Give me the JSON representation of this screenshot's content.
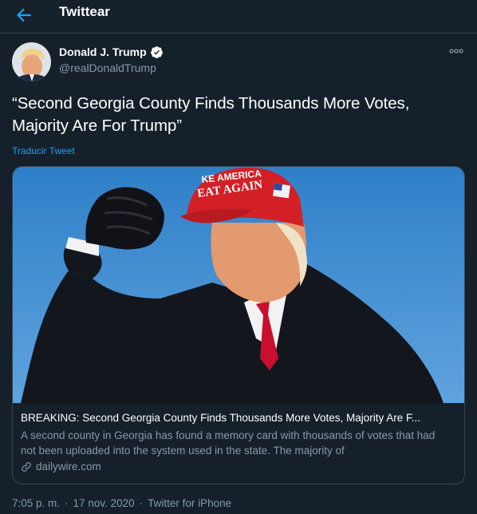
{
  "header": {
    "back_icon": "arrow-left-icon",
    "title": "Twittear"
  },
  "author": {
    "name": "Donald J. Trump",
    "handle": "@realDonaldTrump",
    "verified_icon": "verified-badge-icon"
  },
  "tweet": {
    "text": "“Second Georgia County Finds Thousands More Votes, Majority Are For Trump”",
    "translate_label": "Traducir Tweet"
  },
  "card": {
    "title": "BREAKING: Second Georgia County Finds Thousands More Votes, Majority Are F...",
    "description": "A second county in Georgia has found a memory card with thousands of votes that had not been uploaded into the system used in the state. The majority of",
    "domain": "dailywire.com",
    "hat_text": "EAT AGAIN",
    "hat_text_top": "KE AMERICA"
  },
  "meta": {
    "time": "7:05 p. m.",
    "separator": "·",
    "date": "17 nov. 2020",
    "source": "Twitter for iPhone"
  },
  "colors": {
    "background": "#15202b",
    "accent": "#1da1f2",
    "secondary_text": "#8899a6",
    "border": "#38444d"
  }
}
